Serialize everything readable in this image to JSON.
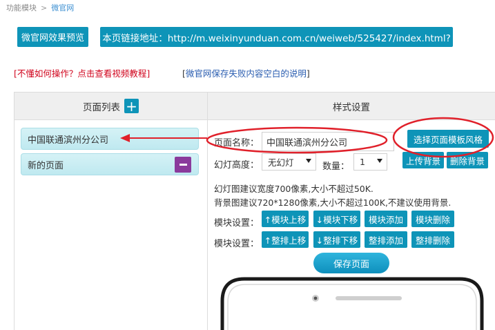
{
  "breadcrumb": {
    "root": "功能模块",
    "separator": ">",
    "current": "微官网"
  },
  "top": {
    "preview_label": "微官网效果预览",
    "url_label": "本页链接地址：http://m.weixinyunduan.com.cn/weiweb/525427/index.html?"
  },
  "help": {
    "video_tutorial": "不懂如何操作？点击查看视频教程",
    "save_failure_note": "微官网保存失败内容空白的说明",
    "bracket_open": "[",
    "bracket_close": "]"
  },
  "left_panel": {
    "title": "页面列表",
    "add_symbol": "+",
    "pages": [
      {
        "name": "中国联通滨州分公司"
      },
      {
        "name": "新的页面"
      }
    ]
  },
  "right_panel": {
    "title": "样式设置",
    "page_name_label": "页面名称：",
    "page_name_value": "中国联通滨州分公司",
    "choose_template_label": "选择页面模板风格",
    "slide_height_label": "幻灯高度：",
    "slide_height_value": "无幻灯",
    "count_label": "数量：",
    "count_value": "1",
    "upload_bg_label": "上传背景",
    "delete_bg_label": "删除背景",
    "tip_slide": "幻灯图建议宽度700像素,大小不超过50K.",
    "tip_background": "背景图建议720*1280像素,大小不超过100K,不建议使用背景.",
    "module_row_label": "模块设置：",
    "module_buttons": [
      "↑模块上移",
      "↓模块下移",
      "模块添加",
      "模块删除"
    ],
    "row_buttons": [
      "↑整排上移",
      "↓整排下移",
      "整排添加",
      "整排删除"
    ],
    "save_label": "保存页面"
  },
  "colors": {
    "accent": "#0e94b8",
    "danger_link": "#d0021b",
    "info_link": "#2a5db0",
    "annotation": "#e0202a",
    "delete_page": "#8a3a9c"
  }
}
